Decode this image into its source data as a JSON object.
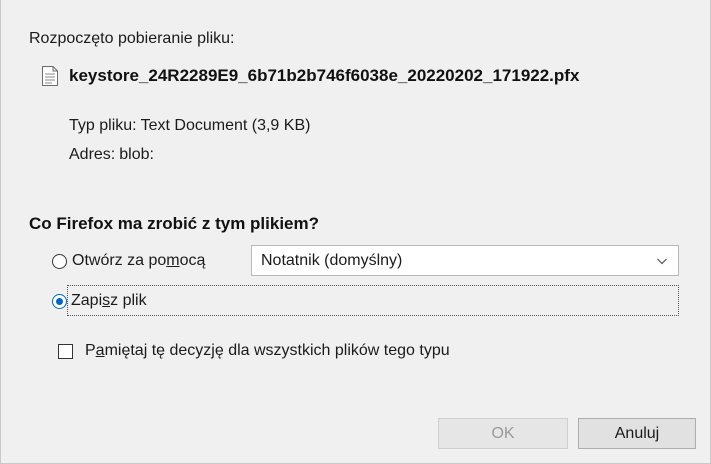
{
  "dialog": {
    "header": "Rozpoczęto pobieranie pliku:",
    "file_name": "keystore_24R2289E9_6b71b2b746f6038e_20220202_171922.pfx",
    "file_type_label": "Typ pliku:",
    "file_type_value": "Text Document (3,9 KB)",
    "address_label": "Adres:",
    "address_value": "blob:",
    "question": "Co Firefox ma zrobić z tym plikiem?"
  },
  "options": {
    "open_with": {
      "label_pre": "Otwórz za po",
      "label_access": "m",
      "label_post": "ocą",
      "selected": false
    },
    "app_select": {
      "value": "Notatnik (domyślny)"
    },
    "save_file": {
      "label_pre": "Zapi",
      "label_access": "s",
      "label_post": "z plik",
      "selected": true
    },
    "remember": {
      "label_pre": "P",
      "label_access": "a",
      "label_post": "miętaj tę decyzję dla wszystkich plików tego typu",
      "checked": false
    }
  },
  "buttons": {
    "ok_label": "OK",
    "cancel_label": "Anuluj"
  },
  "colors": {
    "accent": "#0067c0",
    "background": "#f0f0f0",
    "disabled_text": "#9a9a9a"
  },
  "icons": {
    "file": "document-icon",
    "dropdown": "chevron-down-icon"
  }
}
